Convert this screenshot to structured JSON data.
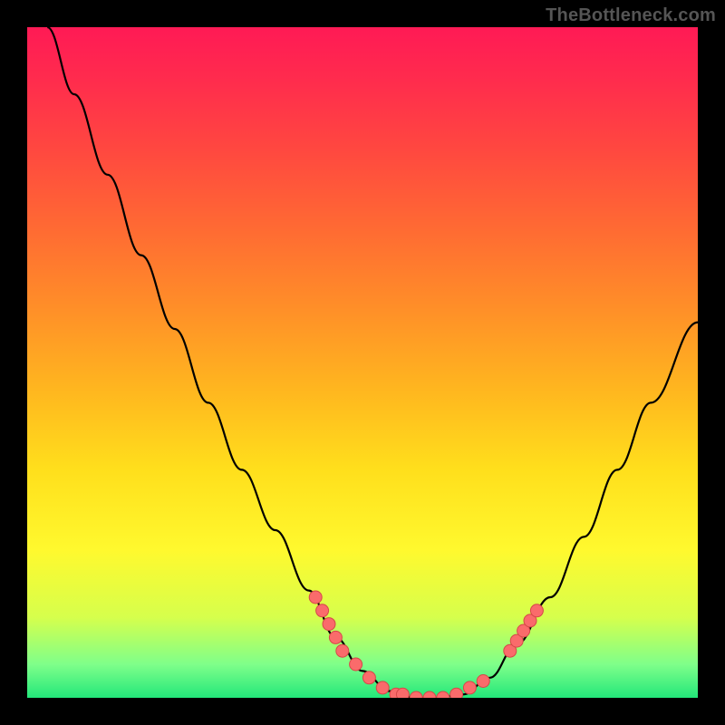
{
  "watermark": "TheBottleneck.com",
  "colors": {
    "background": "#000000",
    "curve_stroke": "#000000",
    "marker_fill": "#fa6b6b",
    "marker_stroke": "#d64848"
  },
  "chart_data": {
    "type": "line",
    "title": "",
    "xlabel": "",
    "ylabel": "",
    "xlim": [
      0,
      100
    ],
    "ylim": [
      0,
      100
    ],
    "grid": false,
    "legend": null,
    "curve": [
      {
        "x": 3,
        "y": 100
      },
      {
        "x": 7,
        "y": 90
      },
      {
        "x": 12,
        "y": 78
      },
      {
        "x": 17,
        "y": 66
      },
      {
        "x": 22,
        "y": 55
      },
      {
        "x": 27,
        "y": 44
      },
      {
        "x": 32,
        "y": 34
      },
      {
        "x": 37,
        "y": 25
      },
      {
        "x": 42,
        "y": 16
      },
      {
        "x": 46,
        "y": 9
      },
      {
        "x": 50,
        "y": 4
      },
      {
        "x": 54,
        "y": 1
      },
      {
        "x": 58,
        "y": 0
      },
      {
        "x": 61,
        "y": 0
      },
      {
        "x": 65,
        "y": 0.5
      },
      {
        "x": 69,
        "y": 3
      },
      {
        "x": 73,
        "y": 8
      },
      {
        "x": 78,
        "y": 15
      },
      {
        "x": 83,
        "y": 24
      },
      {
        "x": 88,
        "y": 34
      },
      {
        "x": 93,
        "y": 44
      },
      {
        "x": 100,
        "y": 56
      }
    ],
    "markers": [
      {
        "x": 43,
        "y": 15
      },
      {
        "x": 44,
        "y": 13
      },
      {
        "x": 45,
        "y": 11
      },
      {
        "x": 46,
        "y": 9
      },
      {
        "x": 47,
        "y": 7
      },
      {
        "x": 49,
        "y": 5
      },
      {
        "x": 51,
        "y": 3
      },
      {
        "x": 53,
        "y": 1.5
      },
      {
        "x": 55,
        "y": 0.5
      },
      {
        "x": 56,
        "y": 0.5
      },
      {
        "x": 58,
        "y": 0
      },
      {
        "x": 60,
        "y": 0
      },
      {
        "x": 62,
        "y": 0
      },
      {
        "x": 64,
        "y": 0.5
      },
      {
        "x": 66,
        "y": 1.5
      },
      {
        "x": 68,
        "y": 2.5
      },
      {
        "x": 72,
        "y": 7
      },
      {
        "x": 73,
        "y": 8.5
      },
      {
        "x": 74,
        "y": 10
      },
      {
        "x": 75,
        "y": 11.5
      },
      {
        "x": 76,
        "y": 13
      }
    ]
  }
}
